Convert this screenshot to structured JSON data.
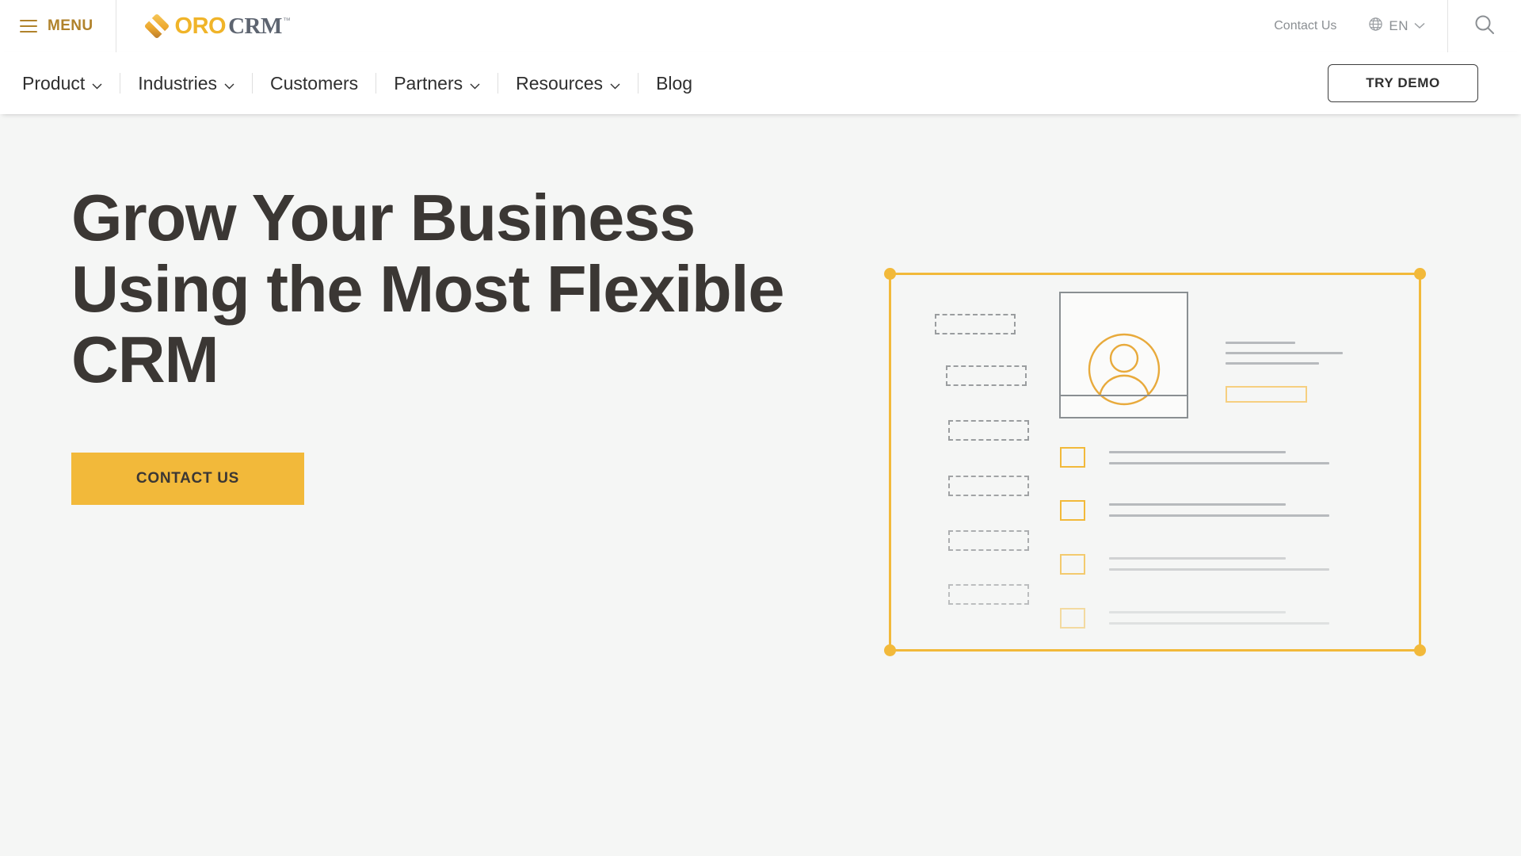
{
  "topbar": {
    "menu_label": "MENU",
    "menu_icon": "hamburger-icon",
    "logo": {
      "mark_icon": "oro-diamond-logo-icon",
      "oro": "ORO",
      "crm": "CRM",
      "tm": "™"
    },
    "contact_us": "Contact Us",
    "language": {
      "icon": "globe-icon",
      "code": "EN",
      "chevron": "chevron-down-icon"
    },
    "search_icon": "search-icon"
  },
  "nav": {
    "items": [
      {
        "label": "Product",
        "has_dropdown": true
      },
      {
        "label": "Industries",
        "has_dropdown": true
      },
      {
        "label": "Customers",
        "has_dropdown": false
      },
      {
        "label": "Partners",
        "has_dropdown": true
      },
      {
        "label": "Resources",
        "has_dropdown": true
      },
      {
        "label": "Blog",
        "has_dropdown": false
      }
    ],
    "try_demo_label": "TRY DEMO"
  },
  "hero": {
    "title": "Grow Your Business Using the Most Flexible CRM",
    "cta_label": "CONTACT US",
    "background_color": "#f5f6f5"
  },
  "illustration": {
    "name": "crm-wireframe-illustration",
    "frame_color": "#f2b93a",
    "avatar_icon": "user-avatar-icon",
    "accent_color": "#f2b93a",
    "line_color": "#b7babd",
    "dash_color": "#9a9d9f",
    "dashed_labels": 6,
    "list_rows": 4
  },
  "colors": {
    "brand_amber": "#f2b93a",
    "menu_gold": "#b0822b",
    "logo_crm_gray": "#5d6470",
    "heading_dark": "#3b3734",
    "muted_text": "#8b8f93",
    "hero_bg": "#f5f6f5"
  }
}
